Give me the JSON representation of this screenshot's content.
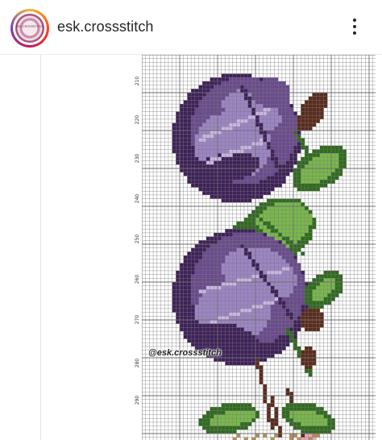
{
  "post": {
    "username": "esk.crossstitch",
    "avatar_text": "ESK.CROSSSTITCH",
    "more_icon": "more-vertical-icon"
  },
  "pattern": {
    "row_labels": [
      "210",
      "220",
      "230",
      "240",
      "250",
      "260",
      "270",
      "280",
      "290"
    ],
    "watermark": "@esk.crossstitch",
    "colors": {
      "grid": "#6f6f6f",
      "purple_dark": "#3e2159",
      "purple_mid": "#6a4a8f",
      "purple_light": "#9d85c5",
      "purple_pale": "#c9b6e2",
      "leaf_dark": "#2f6b1e",
      "leaf_light": "#79b84a",
      "stem_brown": "#5a2b1c",
      "gold": "#b39055",
      "pink": "#e6a6c0"
    }
  }
}
